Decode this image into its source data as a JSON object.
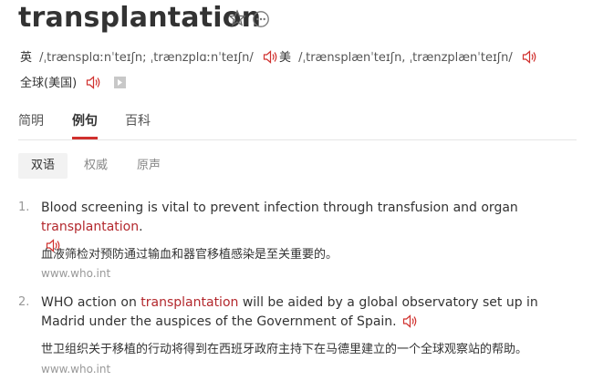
{
  "word": "transplantation",
  "pronunciation": {
    "uk_label": "英",
    "uk_phonetic": "/ˌtrænsplɑːnˈteɪʃn; ˌtrænzplɑːnˈteɪʃn/",
    "us_label": "美",
    "us_phonetic": "/ˌtrænsplænˈteɪʃn, ˌtrænzplænˈteɪʃn/",
    "global_label": "全球(美国)"
  },
  "tabs": [
    "简明",
    "例句",
    "百科"
  ],
  "active_tab": "例句",
  "subtabs": [
    "双语",
    "权威",
    "原声"
  ],
  "active_subtab": "双语",
  "examples": [
    {
      "number": "1.",
      "en_before": "Blood screening is vital to prevent infection through transfusion and organ ",
      "en_highlight": "transplantation",
      "en_after": ".",
      "zh": "血液筛检对预防通过输血和器官移植感染是至关重要的。",
      "source": "www.who.int"
    },
    {
      "number": "2.",
      "en_before": "WHO action on ",
      "en_highlight": "transplantation",
      "en_after": " will be aided by a global observatory set up in Madrid under the auspices of the Government of Spain.",
      "zh": "世卫组织关于移植的行动将得到在西班牙政府主持下在马德里建立的一个全球观察站的帮助。",
      "source": "www.who.int"
    }
  ],
  "colors": {
    "accent": "#d0302d",
    "highlight": "#b3282d"
  }
}
